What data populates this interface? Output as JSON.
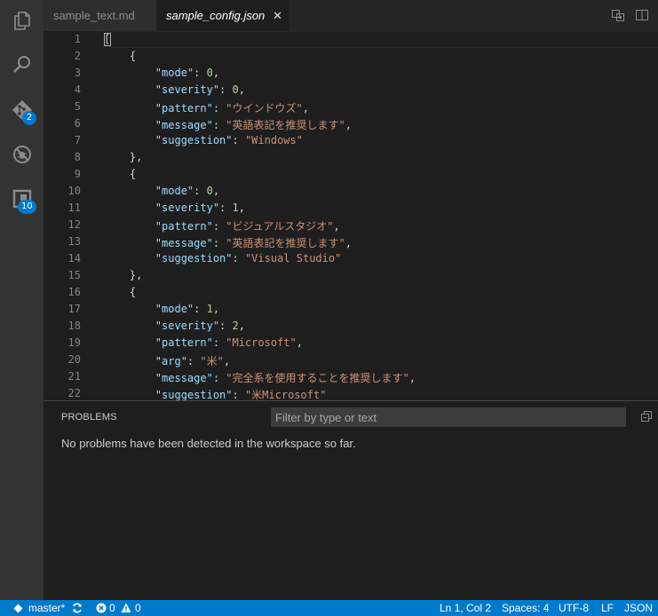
{
  "activity_bar": {
    "items": [
      {
        "icon": "explorer-icon"
      },
      {
        "icon": "search-icon"
      },
      {
        "icon": "git-icon",
        "badge": "2"
      },
      {
        "icon": "debug-icon"
      },
      {
        "icon": "extensions-icon",
        "badge": "10"
      }
    ]
  },
  "tabs": [
    {
      "label": "sample_text.md",
      "active": false
    },
    {
      "label": "sample_config.json",
      "active": true,
      "close": "✕"
    }
  ],
  "editor": {
    "line_numbers": [
      "1",
      "2",
      "3",
      "4",
      "5",
      "6",
      "7",
      "8",
      "9",
      "10",
      "11",
      "12",
      "13",
      "14",
      "15",
      "16",
      "17",
      "18",
      "19",
      "20",
      "21",
      "22"
    ],
    "lines": [
      [
        {
          "t": "p",
          "v": "["
        }
      ],
      [
        {
          "t": "p",
          "v": "    {"
        }
      ],
      [
        {
          "t": "p",
          "v": "        "
        },
        {
          "t": "k",
          "v": "\"mode\""
        },
        {
          "t": "p",
          "v": ": "
        },
        {
          "t": "n",
          "v": "0"
        },
        {
          "t": "p",
          "v": ","
        }
      ],
      [
        {
          "t": "p",
          "v": "        "
        },
        {
          "t": "k",
          "v": "\"severity\""
        },
        {
          "t": "p",
          "v": ": "
        },
        {
          "t": "n",
          "v": "0"
        },
        {
          "t": "p",
          "v": ","
        }
      ],
      [
        {
          "t": "p",
          "v": "        "
        },
        {
          "t": "k",
          "v": "\"pattern\""
        },
        {
          "t": "p",
          "v": ": "
        },
        {
          "t": "s",
          "v": "\"ウインドウズ\""
        },
        {
          "t": "p",
          "v": ","
        }
      ],
      [
        {
          "t": "p",
          "v": "        "
        },
        {
          "t": "k",
          "v": "\"message\""
        },
        {
          "t": "p",
          "v": ": "
        },
        {
          "t": "s",
          "v": "\"英語表記を推奨します\""
        },
        {
          "t": "p",
          "v": ","
        }
      ],
      [
        {
          "t": "p",
          "v": "        "
        },
        {
          "t": "k",
          "v": "\"suggestion\""
        },
        {
          "t": "p",
          "v": ": "
        },
        {
          "t": "s",
          "v": "\"Windows\""
        }
      ],
      [
        {
          "t": "p",
          "v": "    },"
        }
      ],
      [
        {
          "t": "p",
          "v": "    {"
        }
      ],
      [
        {
          "t": "p",
          "v": "        "
        },
        {
          "t": "k",
          "v": "\"mode\""
        },
        {
          "t": "p",
          "v": ": "
        },
        {
          "t": "n",
          "v": "0"
        },
        {
          "t": "p",
          "v": ","
        }
      ],
      [
        {
          "t": "p",
          "v": "        "
        },
        {
          "t": "k",
          "v": "\"severity\""
        },
        {
          "t": "p",
          "v": ": "
        },
        {
          "t": "n",
          "v": "1"
        },
        {
          "t": "p",
          "v": ","
        }
      ],
      [
        {
          "t": "p",
          "v": "        "
        },
        {
          "t": "k",
          "v": "\"pattern\""
        },
        {
          "t": "p",
          "v": ": "
        },
        {
          "t": "s",
          "v": "\"ビジュアルスタジオ\""
        },
        {
          "t": "p",
          "v": ","
        }
      ],
      [
        {
          "t": "p",
          "v": "        "
        },
        {
          "t": "k",
          "v": "\"message\""
        },
        {
          "t": "p",
          "v": ": "
        },
        {
          "t": "s",
          "v": "\"英語表記を推奨します\""
        },
        {
          "t": "p",
          "v": ","
        }
      ],
      [
        {
          "t": "p",
          "v": "        "
        },
        {
          "t": "k",
          "v": "\"suggestion\""
        },
        {
          "t": "p",
          "v": ": "
        },
        {
          "t": "s",
          "v": "\"Visual Studio\""
        }
      ],
      [
        {
          "t": "p",
          "v": "    },"
        }
      ],
      [
        {
          "t": "p",
          "v": "    {"
        }
      ],
      [
        {
          "t": "p",
          "v": "        "
        },
        {
          "t": "k",
          "v": "\"mode\""
        },
        {
          "t": "p",
          "v": ": "
        },
        {
          "t": "n",
          "v": "1"
        },
        {
          "t": "p",
          "v": ","
        }
      ],
      [
        {
          "t": "p",
          "v": "        "
        },
        {
          "t": "k",
          "v": "\"severity\""
        },
        {
          "t": "p",
          "v": ": "
        },
        {
          "t": "n",
          "v": "2"
        },
        {
          "t": "p",
          "v": ","
        }
      ],
      [
        {
          "t": "p",
          "v": "        "
        },
        {
          "t": "k",
          "v": "\"pattern\""
        },
        {
          "t": "p",
          "v": ": "
        },
        {
          "t": "s",
          "v": "\"Microsoft\""
        },
        {
          "t": "p",
          "v": ","
        }
      ],
      [
        {
          "t": "p",
          "v": "        "
        },
        {
          "t": "k",
          "v": "\"arg\""
        },
        {
          "t": "p",
          "v": ": "
        },
        {
          "t": "s",
          "v": "\"米\""
        },
        {
          "t": "p",
          "v": ","
        }
      ],
      [
        {
          "t": "p",
          "v": "        "
        },
        {
          "t": "k",
          "v": "\"message\""
        },
        {
          "t": "p",
          "v": ": "
        },
        {
          "t": "s",
          "v": "\"完全系を使用することを推奨します\""
        },
        {
          "t": "p",
          "v": ","
        }
      ],
      [
        {
          "t": "p",
          "v": "        "
        },
        {
          "t": "k",
          "v": "\"suggestion\""
        },
        {
          "t": "p",
          "v": ": "
        },
        {
          "t": "s",
          "v": "\"米Microsoft\""
        }
      ]
    ]
  },
  "panel": {
    "title": "PROBLEMS",
    "filter_placeholder": "Filter by type or text",
    "filter_value": "",
    "message": "No problems have been detected in the workspace so far."
  },
  "status_bar": {
    "branch": "master*",
    "errors": "0",
    "warnings": "0",
    "position": "Ln 1, Col 2",
    "indent": "Spaces: 4",
    "encoding": "UTF-8",
    "eol": "LF",
    "language": "JSON"
  },
  "colors": {
    "accent": "#007acc",
    "key": "#9cdcfe",
    "string": "#ce9178",
    "number": "#b5cea8",
    "punctuation": "#d4d4d4"
  }
}
